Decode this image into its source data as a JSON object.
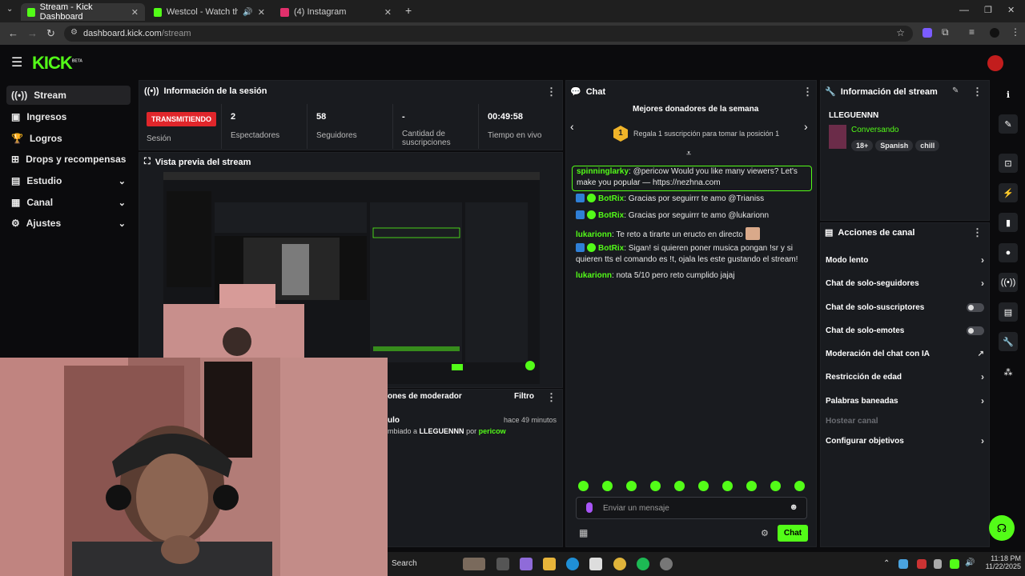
{
  "browser": {
    "tabs": [
      {
        "title": "Stream - Kick Dashboard",
        "active": true
      },
      {
        "title": "Westcol - Watch the VOD o",
        "active": false
      },
      {
        "title": "(4) Instagram",
        "active": false
      }
    ],
    "url_host": "dashboard.kick.com",
    "url_path": "/stream"
  },
  "brand": {
    "logo": "KICK",
    "logo_tag": "BETA",
    "accent": "#53fc18"
  },
  "sidebar": {
    "items": [
      {
        "label": "Stream",
        "icon": "signal-icon",
        "active": true
      },
      {
        "label": "Ingresos",
        "icon": "wallet-icon"
      },
      {
        "label": "Logros",
        "icon": "trophy-icon"
      },
      {
        "label": "Drops y recompensas",
        "icon": "gift-icon"
      },
      {
        "label": "Estudio",
        "icon": "studio-icon",
        "expandable": true
      },
      {
        "label": "Canal",
        "icon": "channel-icon",
        "expandable": true
      },
      {
        "label": "Ajustes",
        "icon": "gear-icon",
        "expandable": true
      }
    ]
  },
  "session": {
    "title": "Información de la sesión",
    "live_badge": "TRANSMITIENDO",
    "session_label": "Sesión",
    "stats": [
      {
        "value": "2",
        "label": "Espectadores"
      },
      {
        "value": "58",
        "label": "Seguidores"
      },
      {
        "value": "-",
        "label": "Cantidad de suscripciones"
      },
      {
        "value": "00:49:58",
        "label": "Tiempo en vivo"
      }
    ]
  },
  "preview": {
    "title": "Vista previa del stream"
  },
  "modlog": {
    "title": "ones de moderador",
    "filter": "Filtro",
    "entry_title": "ulo",
    "entry_time": "hace 49 minutos",
    "entry_text_pre": "mbiado a",
    "entry_user": "LLEGUENNN",
    "entry_by": "por",
    "entry_mod": "pericow"
  },
  "chat": {
    "title": "Chat",
    "donors_title": "Mejores donadores de la semana",
    "donors_rank": "1",
    "donors_cta": "Regala 1 suscripción para tomar la posición 1",
    "messages": [
      {
        "user": "spinninglarky",
        "text": "@pericow Would you like many viewers? Let's make you popular — https://nezhna.com",
        "user_color": "#53fc18",
        "bot": false
      },
      {
        "user": "BotRix",
        "text": "Gracias por seguirrr te amo @Trianiss",
        "user_color": "#53fc18",
        "bot": true
      },
      {
        "user": "BotRix",
        "text": "Gracias por seguirrr te amo @lukarionn",
        "user_color": "#53fc18",
        "bot": true
      },
      {
        "user": "lukarionn",
        "text": "Te reto a tirarte un eructo en directo",
        "user_color": "#53fc18",
        "bot": false
      },
      {
        "user": "BotRix",
        "text": "Sigan! si quieren poner musica pongan !sr y si quieren tts el comando es !t, ojala les este gustando el stream!",
        "user_color": "#53fc18",
        "bot": true
      },
      {
        "user": "lukarionn",
        "text": "nota 5/10 pero reto cumplido jajaj",
        "user_color": "#53fc18",
        "bot": false
      }
    ],
    "input_placeholder": "Enviar un mensaje",
    "send_label": "Chat"
  },
  "stream_info": {
    "title": "Información del stream",
    "stream_title": "LLEGUENNN",
    "category": "Conversando",
    "tags": [
      "18+",
      "Spanish",
      "chill"
    ]
  },
  "actions": {
    "title": "Acciones de canal",
    "items": [
      {
        "label": "Modo lento",
        "control": "chevron"
      },
      {
        "label": "Chat de solo-seguidores",
        "control": "chevron"
      },
      {
        "label": "Chat de solo-suscriptores",
        "control": "toggle"
      },
      {
        "label": "Chat de solo-emotes",
        "control": "toggle"
      },
      {
        "label": "Moderación del chat con IA",
        "control": "external"
      },
      {
        "label": "Restricción de edad",
        "control": "chevron"
      },
      {
        "label": "Palabras baneadas",
        "control": "chevron"
      },
      {
        "label": "Hostear canal",
        "control": "none",
        "disabled": true
      },
      {
        "label": "Configurar objetivos",
        "control": "chevron"
      }
    ]
  },
  "taskbar": {
    "search": "Search",
    "time": "11:18 PM",
    "date": "11/22/2025"
  }
}
